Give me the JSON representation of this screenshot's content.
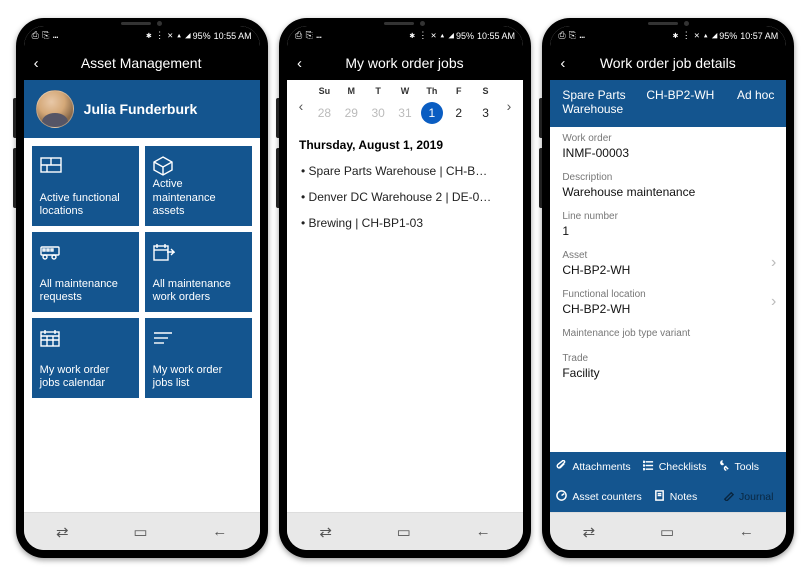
{
  "status": {
    "left_icons": "⎙ ⎘ …",
    "right_icons": "✱ ⋮ ✕ ▴ ◢",
    "battery": "95%",
    "time1": "10:55 AM",
    "time2": "10:55 AM",
    "time3": "10:57 AM"
  },
  "nav": {
    "recent": "⌁",
    "home": "▢",
    "back": "←"
  },
  "screen1": {
    "title": "Asset Management",
    "user": "Julia Funderburk",
    "tiles": [
      {
        "label": "Active functional locations"
      },
      {
        "label": "Active maintenance assets"
      },
      {
        "label": "All maintenance requests"
      },
      {
        "label": "All maintenance work orders"
      },
      {
        "label": "My work order jobs calendar"
      },
      {
        "label": "My work order jobs list"
      }
    ]
  },
  "screen2": {
    "title": "My work order jobs",
    "dow": [
      "Su",
      "M",
      "T",
      "W",
      "Th",
      "F",
      "S"
    ],
    "nums": [
      "28",
      "29",
      "30",
      "31",
      "1",
      "2",
      "3"
    ],
    "selected_index": 4,
    "date_label": "Thursday, August 1, 2019",
    "jobs": [
      "Spare Parts Warehouse | CH-B…",
      "Denver DC Warehouse 2 | DE-0…",
      "Brewing | CH-BP1-03"
    ]
  },
  "screen3": {
    "title": "Work order job details",
    "header": {
      "c1": "Spare Parts Warehouse",
      "c2": "CH-BP2-WH",
      "c3": "Ad hoc"
    },
    "fields": [
      {
        "label": "Work order",
        "value": "INMF-00003"
      },
      {
        "label": "Description",
        "value": "Warehouse maintenance"
      },
      {
        "label": "Line number",
        "value": "1"
      },
      {
        "label": "Asset",
        "value": "CH-BP2-WH",
        "nav": true
      },
      {
        "label": "Functional location",
        "value": "CH-BP2-WH",
        "nav": true
      },
      {
        "label": "Maintenance job type variant",
        "value": ""
      },
      {
        "label": "Trade",
        "value": "Facility"
      }
    ],
    "actions_row1": [
      {
        "label": "Attachments",
        "icon": "clip"
      },
      {
        "label": "Checklists",
        "icon": "list"
      },
      {
        "label": "Tools",
        "icon": "tool"
      }
    ],
    "actions_row2": [
      {
        "label": "Asset counters",
        "icon": "gauge"
      },
      {
        "label": "Notes",
        "icon": "note"
      },
      {
        "label": "Journal",
        "icon": "pen",
        "dim": true
      }
    ]
  }
}
